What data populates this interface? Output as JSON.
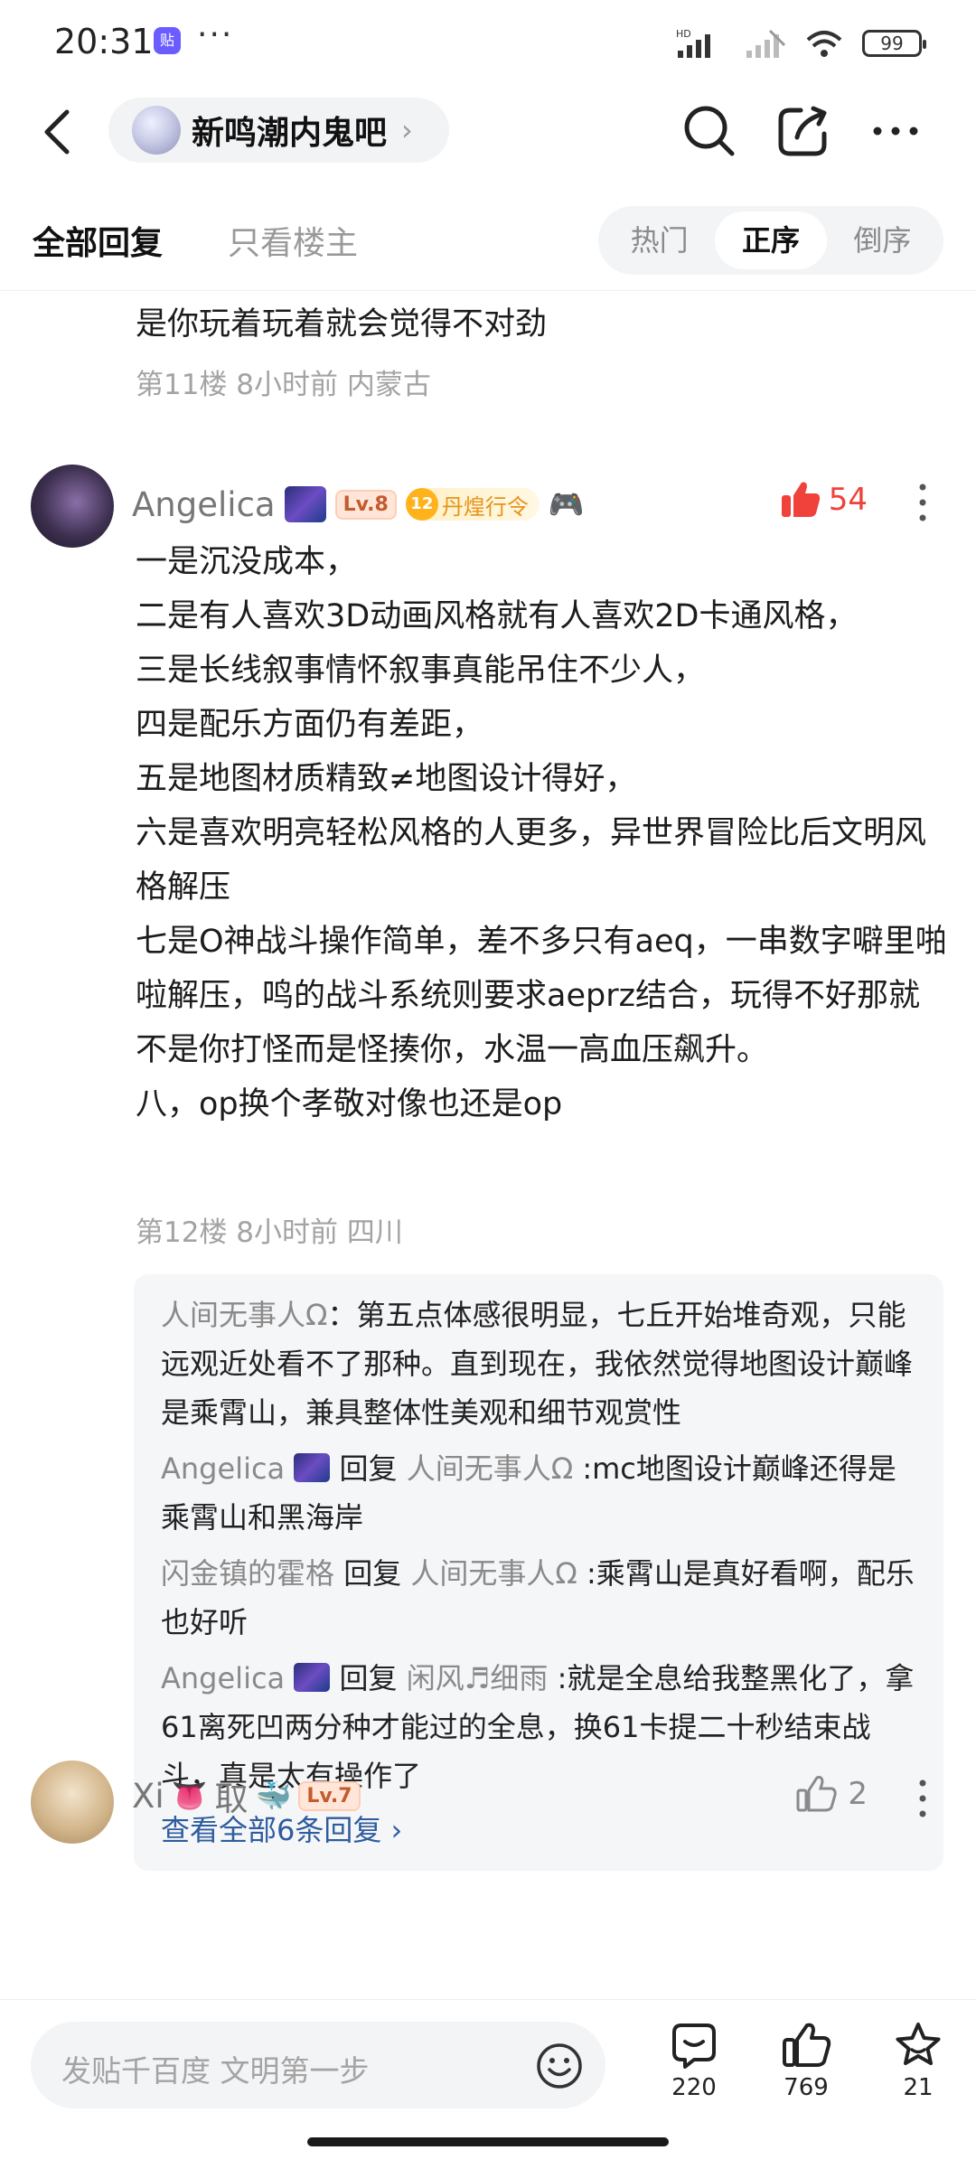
{
  "status": {
    "time": "20:31",
    "app_badge": "贴",
    "dots": "···",
    "network": "HD",
    "battery": "99"
  },
  "nav": {
    "forum_name": "新鸣潮内鬼吧",
    "chevron": "›"
  },
  "filters": {
    "all_replies": "全部回复",
    "op_only": "只看楼主",
    "sort_options": [
      "热门",
      "正序",
      "倒序"
    ],
    "sort_active": "正序"
  },
  "prev_floor": {
    "tail_text": "是你玩着玩着就会觉得不对劲",
    "meta": "第11楼 8小时前 内蒙古"
  },
  "post": {
    "username": "Angelica",
    "level": "Lv.8",
    "medal_num": "12",
    "medal_text": "丹煌行令",
    "likes": "54",
    "lines": [
      "一是沉没成本，",
      "二是有人喜欢3D动画风格就有人喜欢2D卡通风格，",
      "三是长线叙事情怀叙事真能吊住不少人，",
      "四是配乐方面仍有差距，",
      "五是地图材质精致≠地图设计得好，",
      "六是喜欢明亮轻松风格的人更多，异世界冒险比后文明风格解压",
      "七是O神战斗操作简单，差不多只有aeq，一串数字噼里啪啦解压，鸣的战斗系统则要求aeprz结合，玩得不好那就不是你打怪而是怪揍你，水温一高血压飙升。",
      "八，op换个孝敬对像也还是op"
    ],
    "meta": "第12楼 8小时前 四川"
  },
  "replies": [
    {
      "name": "人间无事人Ω",
      "reply_word": "",
      "target": "",
      "text": "：第五点体感很明显，七丘开始堆奇观，只能远观近处看不了那种。直到现在，我依然觉得地图设计巅峰是乘霄山，兼具整体性美观和细节观赏性"
    },
    {
      "name": "Angelica",
      "reply_word": "回复",
      "target": "人间无事人Ω",
      "text": ":mc地图设计巅峰还得是乘霄山和黑海岸"
    },
    {
      "name": "闪金镇的霍格",
      "reply_word": "回复",
      "target": "人间无事人Ω",
      "text": ":乘霄山是真好看啊，配乐也好听"
    },
    {
      "name": "Angelica",
      "reply_word": "回复",
      "target": "闲风♬细雨",
      "text": ":就是全息给我整黑化了，拿61离死凹两分种才能过的全息，换61卡提二十秒结束战斗，真是太有操作了"
    }
  ],
  "view_all": "查看全部6条回复 ›",
  "next_post": {
    "username_prefix": "Xi",
    "username_mid": "取",
    "level": "Lv.7",
    "likes": "2"
  },
  "bottom": {
    "placeholder": "发贴千百度 文明第一步",
    "comments": "220",
    "likes": "769",
    "favorites": "21"
  }
}
